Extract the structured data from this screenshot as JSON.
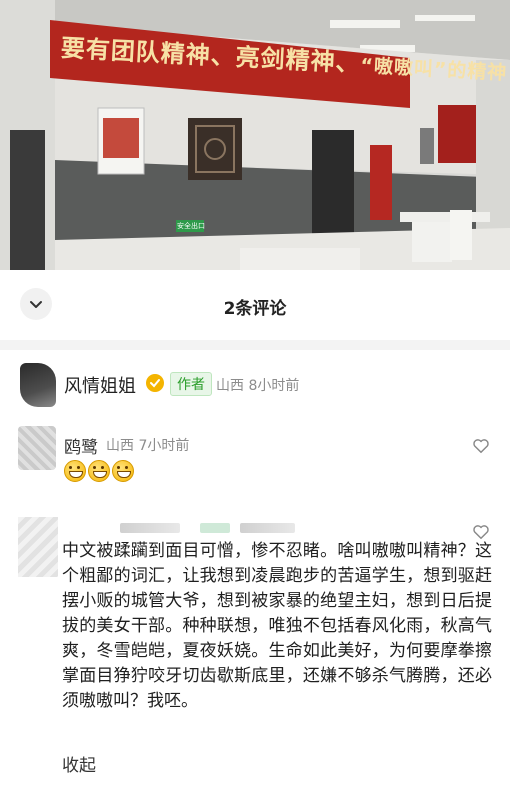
{
  "photo": {
    "banner_text_main": "要有团队精神、亮剑精神、",
    "banner_text_quote": "“嗷嗷叫”的精神",
    "exit_sign": "安全出口"
  },
  "header": {
    "title": "2条评论"
  },
  "author": {
    "name": "风情姐姐",
    "tag": "作者",
    "location": "山西",
    "time": "8小时前"
  },
  "comments": [
    {
      "name": "鸥鹭",
      "location": "山西",
      "time": "7小时前",
      "emoji_count": 3
    },
    {
      "text": "中文被蹂躏到面目可憎，惨不忍睹。啥叫嗷嗷叫精神？这个粗鄙的词汇，让我想到凌晨跑步的苦逼学生，想到驱赶摆小贩的城管大爷，想到被家暴的绝望主妇，想到日后提拔的美女干部。种种联想，唯独不包括春风化雨，秋高气爽，冬雪皑皑，夏夜妖娆。生命如此美好，为何要摩拳擦掌面目狰狞咬牙切齿歇斯底里，还嫌不够杀气腾腾，还必须嗷嗷叫？我呸。",
      "collapse_label": "收起"
    }
  ],
  "colors": {
    "banner_red": "#b3261e",
    "author_tag_green": "#2a9d2a",
    "meta_gray": "#8c8c8c"
  }
}
